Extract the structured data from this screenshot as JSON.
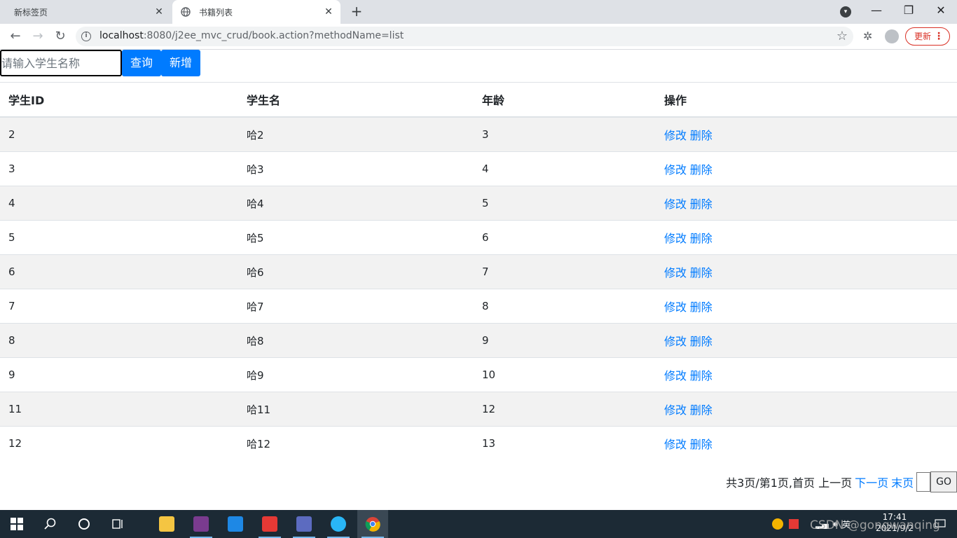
{
  "browser": {
    "tabs": [
      {
        "label": "新标签页"
      },
      {
        "label": "书籍列表"
      }
    ],
    "new_tab": "+",
    "url_host": "localhost",
    "url_rest": ":8080/j2ee_mvc_crud/book.action?methodName=list",
    "update_label": "更新"
  },
  "search": {
    "placeholder": "请输入学生名称",
    "query_label": "查询",
    "add_label": "新增"
  },
  "table": {
    "headers": [
      "学生ID",
      "学生名",
      "年龄",
      "操作"
    ],
    "rows": [
      {
        "id": "2",
        "name": "哈2",
        "age": "3"
      },
      {
        "id": "3",
        "name": "哈3",
        "age": "4"
      },
      {
        "id": "4",
        "name": "哈4",
        "age": "5"
      },
      {
        "id": "5",
        "name": "哈5",
        "age": "6"
      },
      {
        "id": "6",
        "name": "哈6",
        "age": "7"
      },
      {
        "id": "7",
        "name": "哈7",
        "age": "8"
      },
      {
        "id": "8",
        "name": "哈8",
        "age": "9"
      },
      {
        "id": "9",
        "name": "哈9",
        "age": "10"
      },
      {
        "id": "11",
        "name": "哈11",
        "age": "12"
      },
      {
        "id": "12",
        "name": "哈12",
        "age": "13"
      }
    ],
    "edit_label": "修改",
    "delete_label": "删除"
  },
  "pager": {
    "summary": "共3页/第1页,首页 上一页",
    "next_label": "下一页",
    "last_label": "末页",
    "go_label": "GO"
  },
  "taskbar": {
    "time": "17:41",
    "date": "2021/9/2",
    "ime": "英"
  },
  "watermark": "CSDN @gongwanqing",
  "colors": {
    "accent": "#007bff",
    "row_stripe": "#f2f2f2",
    "taskbar": "#1c2a35"
  }
}
